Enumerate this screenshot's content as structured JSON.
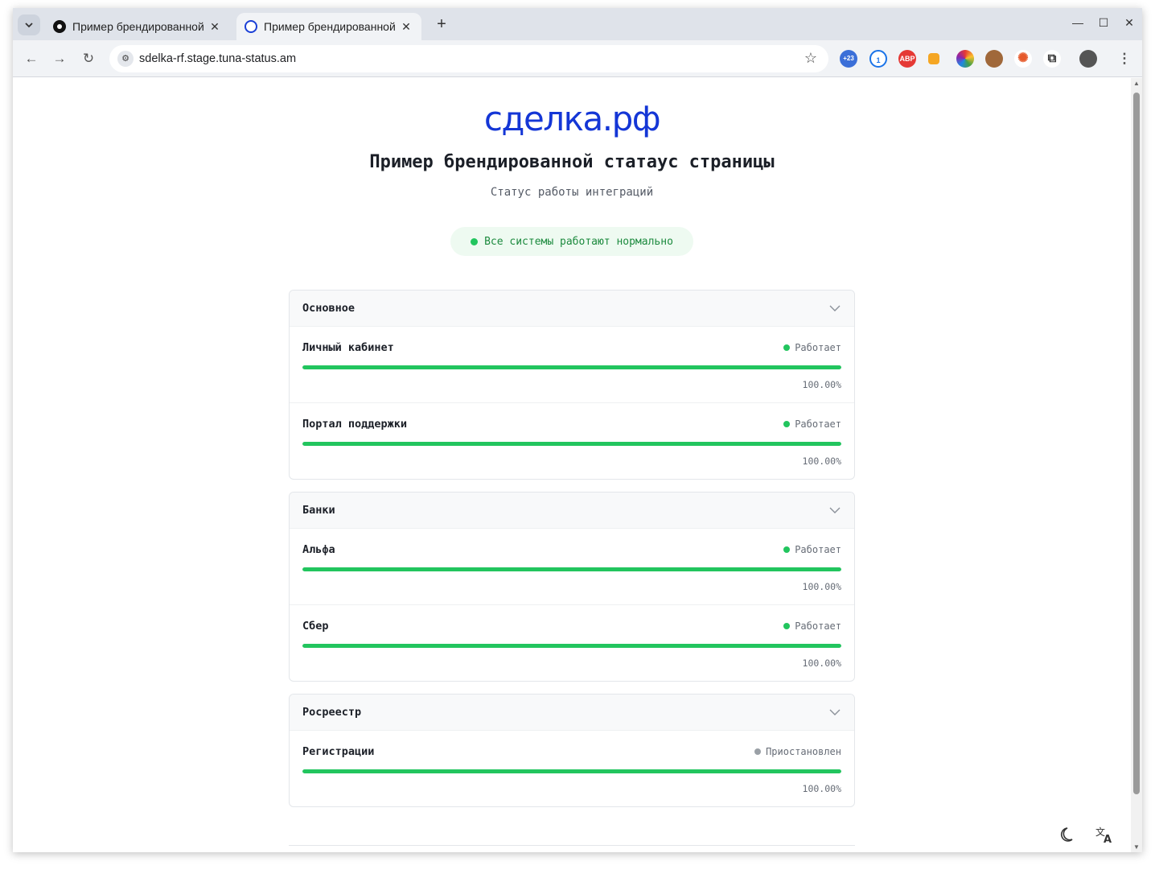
{
  "browser": {
    "tabs": [
      {
        "title": "Пример брендированной",
        "active": false
      },
      {
        "title": "Пример брендированной",
        "active": true
      }
    ],
    "url": "sdelka-rf.stage.tuna-status.am",
    "extension_badge": "+23",
    "abp_label": "ABP"
  },
  "page": {
    "logo": "сделка.рф",
    "title": "Пример брендированной статаус страницы",
    "subtitle": "Статус работы интеграций",
    "overall_status": "Все системы работают нормально",
    "colors": {
      "accent": "#1436d6",
      "ok": "#22c55e",
      "paused": "#9aa0a6"
    }
  },
  "groups": [
    {
      "name": "Основное",
      "services": [
        {
          "name": "Личный кабинет",
          "status": "Работает",
          "uptime": "100.00%",
          "state": "ok"
        },
        {
          "name": "Портал поддержки",
          "status": "Работает",
          "uptime": "100.00%",
          "state": "ok"
        }
      ]
    },
    {
      "name": "Банки",
      "services": [
        {
          "name": "Альфа",
          "status": "Работает",
          "uptime": "100.00%",
          "state": "ok"
        },
        {
          "name": "Сбер",
          "status": "Работает",
          "uptime": "100.00%",
          "state": "ok"
        }
      ]
    },
    {
      "name": "Росреестр",
      "services": [
        {
          "name": "Регистрации",
          "status": "Приостановлен",
          "uptime": "100.00%",
          "state": "paused"
        }
      ]
    }
  ],
  "controls": {
    "theme_toggle_icon": "moon-icon",
    "language_icon": "translate-icon"
  }
}
